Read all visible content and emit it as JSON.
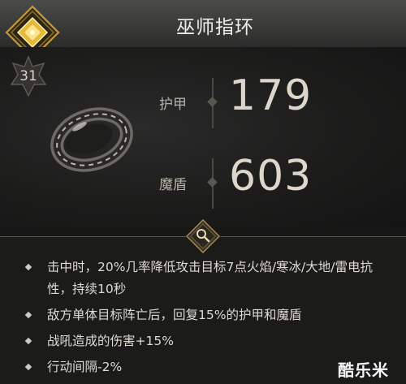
{
  "item": {
    "name": "巫师指环",
    "level": "31"
  },
  "stats": [
    {
      "label": "护甲",
      "value": "179"
    },
    {
      "label": "魔盾",
      "value": "603"
    }
  ],
  "effects": [
    "击中时，20%几率降低攻击目标7点火焰/寒冰/大地/雷电抗性，持续10秒",
    "敌方单体目标阵亡后，回复15%的护甲和魔盾",
    "战吼造成的伤害+15%",
    "行动间隔-2%"
  ],
  "watermark": "酷乐米",
  "colors": {
    "emblem_gold": "#e6b93a",
    "background": "#171716",
    "text": "#e6e1d8"
  },
  "icons": {
    "emblem": "gold-diamond-emblem-icon",
    "level": "star-badge-icon",
    "inspect": "magnifier-icon",
    "item": "ring-icon"
  }
}
